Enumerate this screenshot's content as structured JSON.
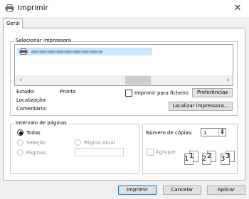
{
  "window": {
    "title": "Imprimir",
    "close_glyph": "✕",
    "app_icon": "print-icon"
  },
  "tabs": [
    {
      "label": "Geral"
    }
  ],
  "printer_section": {
    "title": "Selecionar impressora",
    "selected_printer": {
      "icon": "printer-icon",
      "name_redacted": true
    },
    "scroll_left": "‹",
    "scroll_right": "›"
  },
  "status": {
    "estado_label": "Estado:",
    "estado_value": "Pronto",
    "localizacao_label": "Localização:",
    "comentario_label": "Comentário:"
  },
  "print_to_file": {
    "label": "Imprimir para ficheiro",
    "checked": false
  },
  "buttons": {
    "preferences": "Preferências",
    "find_printer": "Localizar impressora...",
    "print": "Imprimir",
    "cancel": "Cancelar",
    "apply": "Aplicar"
  },
  "page_range": {
    "title": "Intervalo de páginas",
    "options": {
      "all": "Todas",
      "selection": "Seleção",
      "current_page": "Página Atual",
      "pages": "Páginas:"
    },
    "selected": "all",
    "pages_value": ""
  },
  "copies": {
    "label": "Número de cópias:",
    "value": "1",
    "collate_label": "Agrupar",
    "collate_checked": false,
    "collate_preview": [
      "1",
      "1",
      "2",
      "2",
      "3",
      "3"
    ]
  }
}
